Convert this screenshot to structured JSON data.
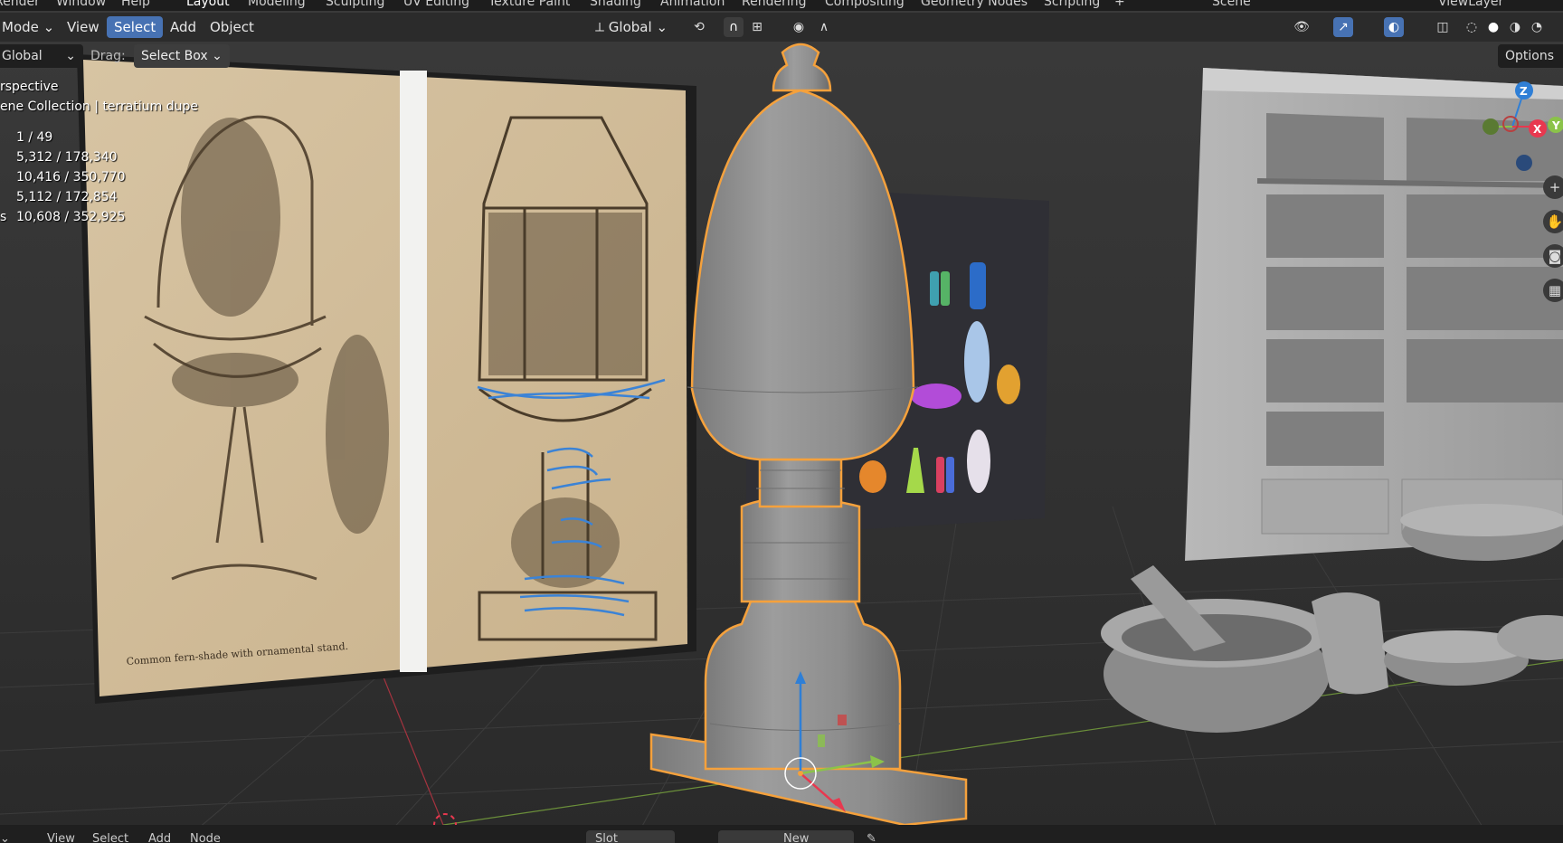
{
  "workspace_tabs": [
    {
      "label": "Render",
      "active": false
    },
    {
      "label": "Window",
      "active": false
    },
    {
      "label": "Help",
      "active": false
    },
    {
      "label": "Layout",
      "active": true
    },
    {
      "label": "Modeling",
      "active": false
    },
    {
      "label": "Sculpting",
      "active": false
    },
    {
      "label": "UV Editing",
      "active": false
    },
    {
      "label": "Texture Paint",
      "active": false
    },
    {
      "label": "Shading",
      "active": false
    },
    {
      "label": "Animation",
      "active": false
    },
    {
      "label": "Rendering",
      "active": false
    },
    {
      "label": "Compositing",
      "active": false
    },
    {
      "label": "Geometry Nodes",
      "active": false
    },
    {
      "label": "Scripting",
      "active": false
    }
  ],
  "scene_name": "Scene",
  "view_layer": "ViewLayer",
  "header": {
    "mode": "Mode",
    "view": "View",
    "select": "Select",
    "add": "Add",
    "object": "Object",
    "transform_orientation": "Global"
  },
  "tool_header": {
    "orientation": "Global",
    "drag_label": "Drag:",
    "drag_value": "Select Box",
    "options": "Options"
  },
  "overlay": {
    "view_name": "rspective",
    "collection": "ene Collection",
    "object_name": "terratium dupe",
    "stats": [
      {
        "label": "",
        "value": "1 / 49"
      },
      {
        "label": "",
        "value": "5,312 / 178,340"
      },
      {
        "label": "",
        "value": "10,416 / 350,770"
      },
      {
        "label": "",
        "value": "5,112 / 172,854"
      },
      {
        "label": "s",
        "value": "10,608 / 352,925"
      }
    ]
  },
  "reference_image": {
    "caption": "Common fern-shade with ornamental stand."
  },
  "gizmo": {
    "z": "Z",
    "y": "Y",
    "x": "X"
  },
  "bottom_bar": {
    "view": "View",
    "select": "Select",
    "add": "Add",
    "node": "Node",
    "slot": "Slot",
    "new": "New"
  },
  "colors": {
    "selection_outline": "#f5a13c",
    "active_button": "#4772b3",
    "axis_x": "#e8384f",
    "axis_y": "#8bc34a",
    "axis_z": "#2f7fd6"
  }
}
